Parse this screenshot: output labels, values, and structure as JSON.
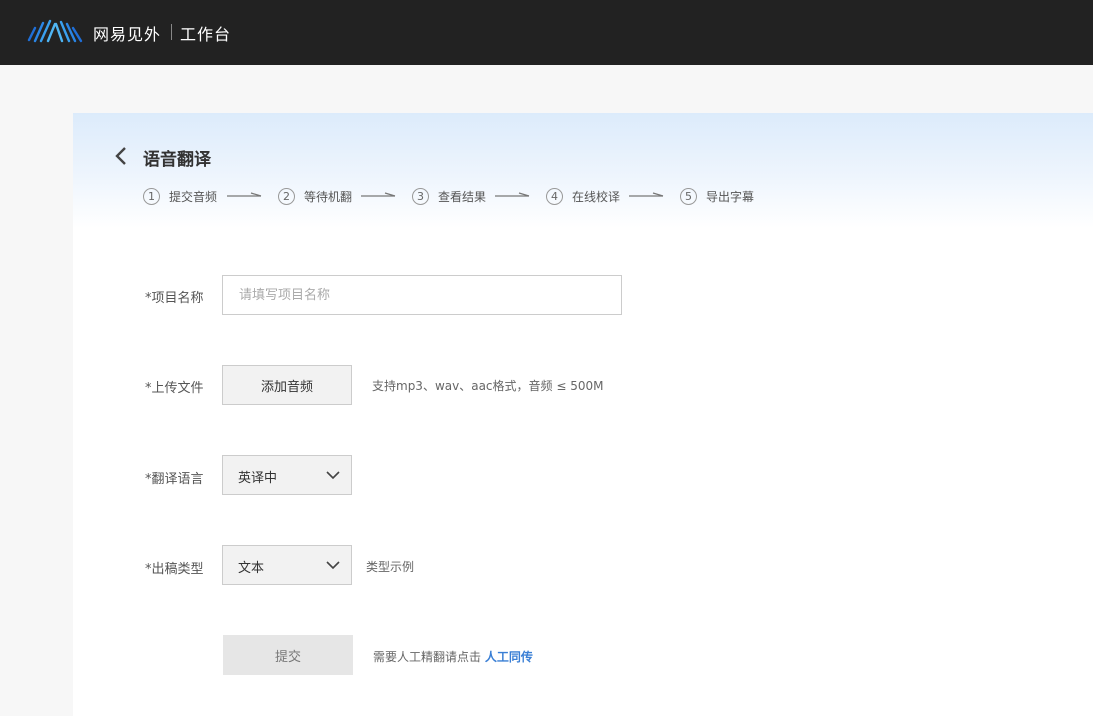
{
  "header": {
    "brand": "网易见外",
    "workspace": "工作台",
    "logo_icon": "waveform-logo-icon"
  },
  "page": {
    "title": "语音翻译",
    "back_icon": "chevron-left-icon"
  },
  "steps": [
    {
      "num": "1",
      "label": "提交音频"
    },
    {
      "num": "2",
      "label": "等待机翻"
    },
    {
      "num": "3",
      "label": "查看结果"
    },
    {
      "num": "4",
      "label": "在线校译"
    },
    {
      "num": "5",
      "label": "导出字幕"
    }
  ],
  "form": {
    "project_name": {
      "label": "*项目名称",
      "placeholder": "请填写项目名称",
      "value": ""
    },
    "upload": {
      "label": "*上传文件",
      "button": "添加音频",
      "hint": "支持mp3、wav、aac格式，音频 ≤ 500M"
    },
    "language": {
      "label": "*翻译语言",
      "selected": "英译中"
    },
    "output_type": {
      "label": "*出稿类型",
      "selected": "文本",
      "hint": "类型示例"
    },
    "submit": {
      "label": "提交",
      "hint_prefix": "需要人工精翻请点击",
      "link": "人工同传"
    }
  },
  "colors": {
    "topbar": "#222222",
    "accent": "#3a7fd5",
    "header_gradient_top": "#dcebfb"
  }
}
